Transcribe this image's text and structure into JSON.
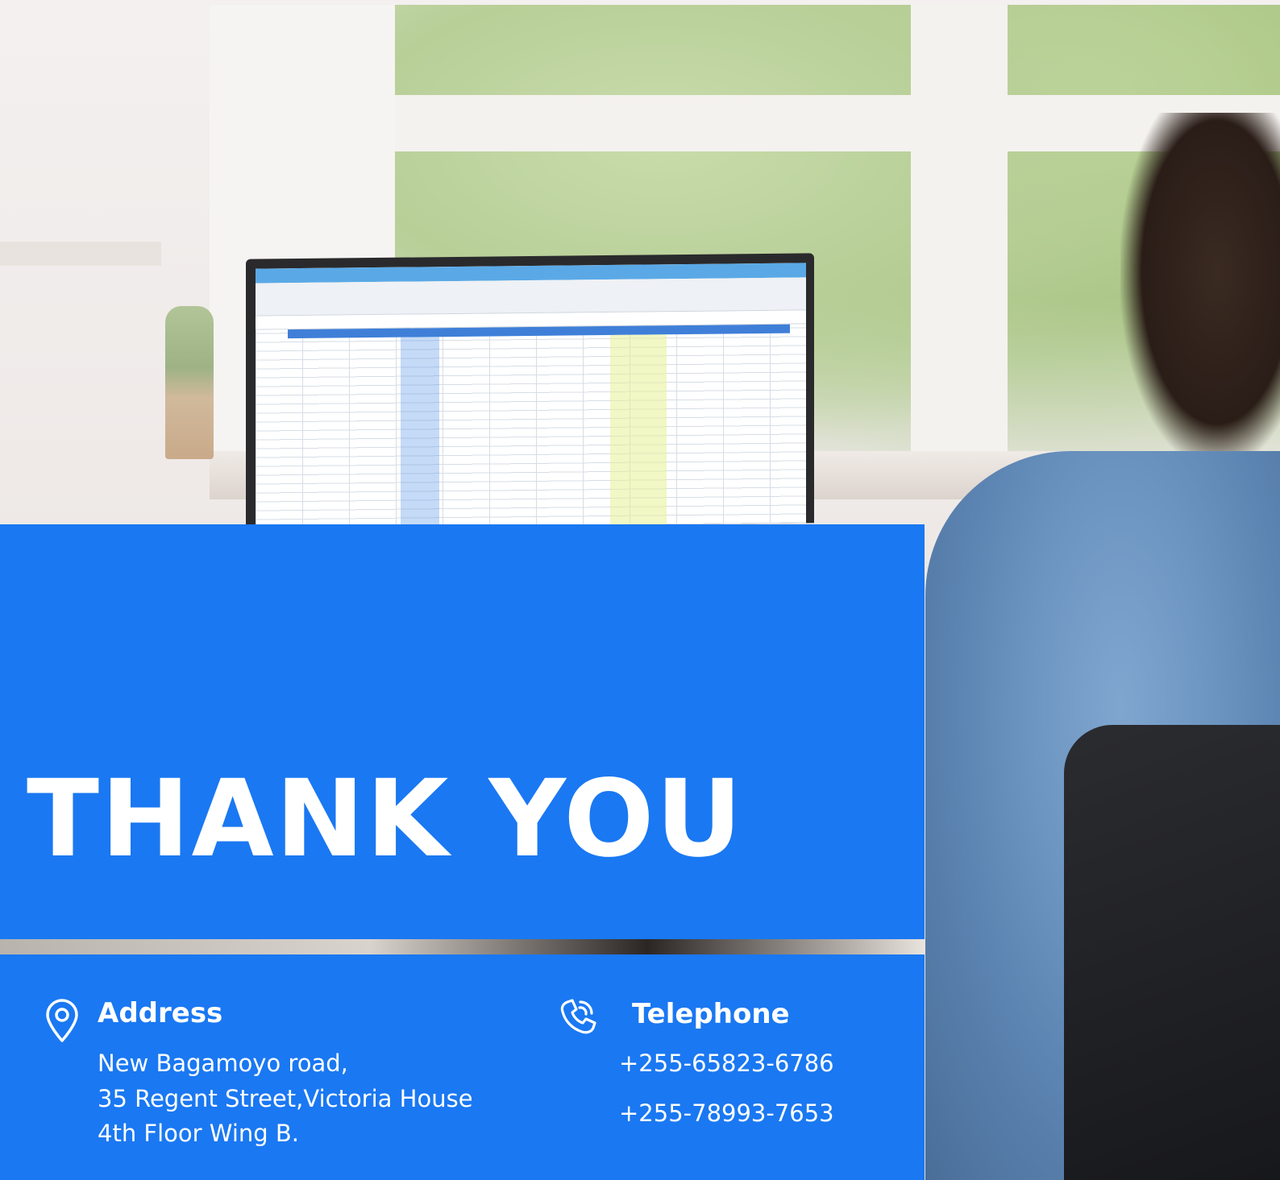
{
  "heading": "THANK YOU",
  "address": {
    "icon": "location-pin-icon",
    "title": "Address",
    "lines": [
      "New Bagamoyo road,",
      "35 Regent Street,Victoria House",
      "4th Floor Wing B."
    ]
  },
  "telephone": {
    "icon": "phone-icon",
    "title": "Telephone",
    "numbers": [
      "+255-65823-6786",
      "+255-78993-7653"
    ]
  },
  "colors": {
    "panel": "#1a78f2",
    "text": "#ffffff"
  }
}
